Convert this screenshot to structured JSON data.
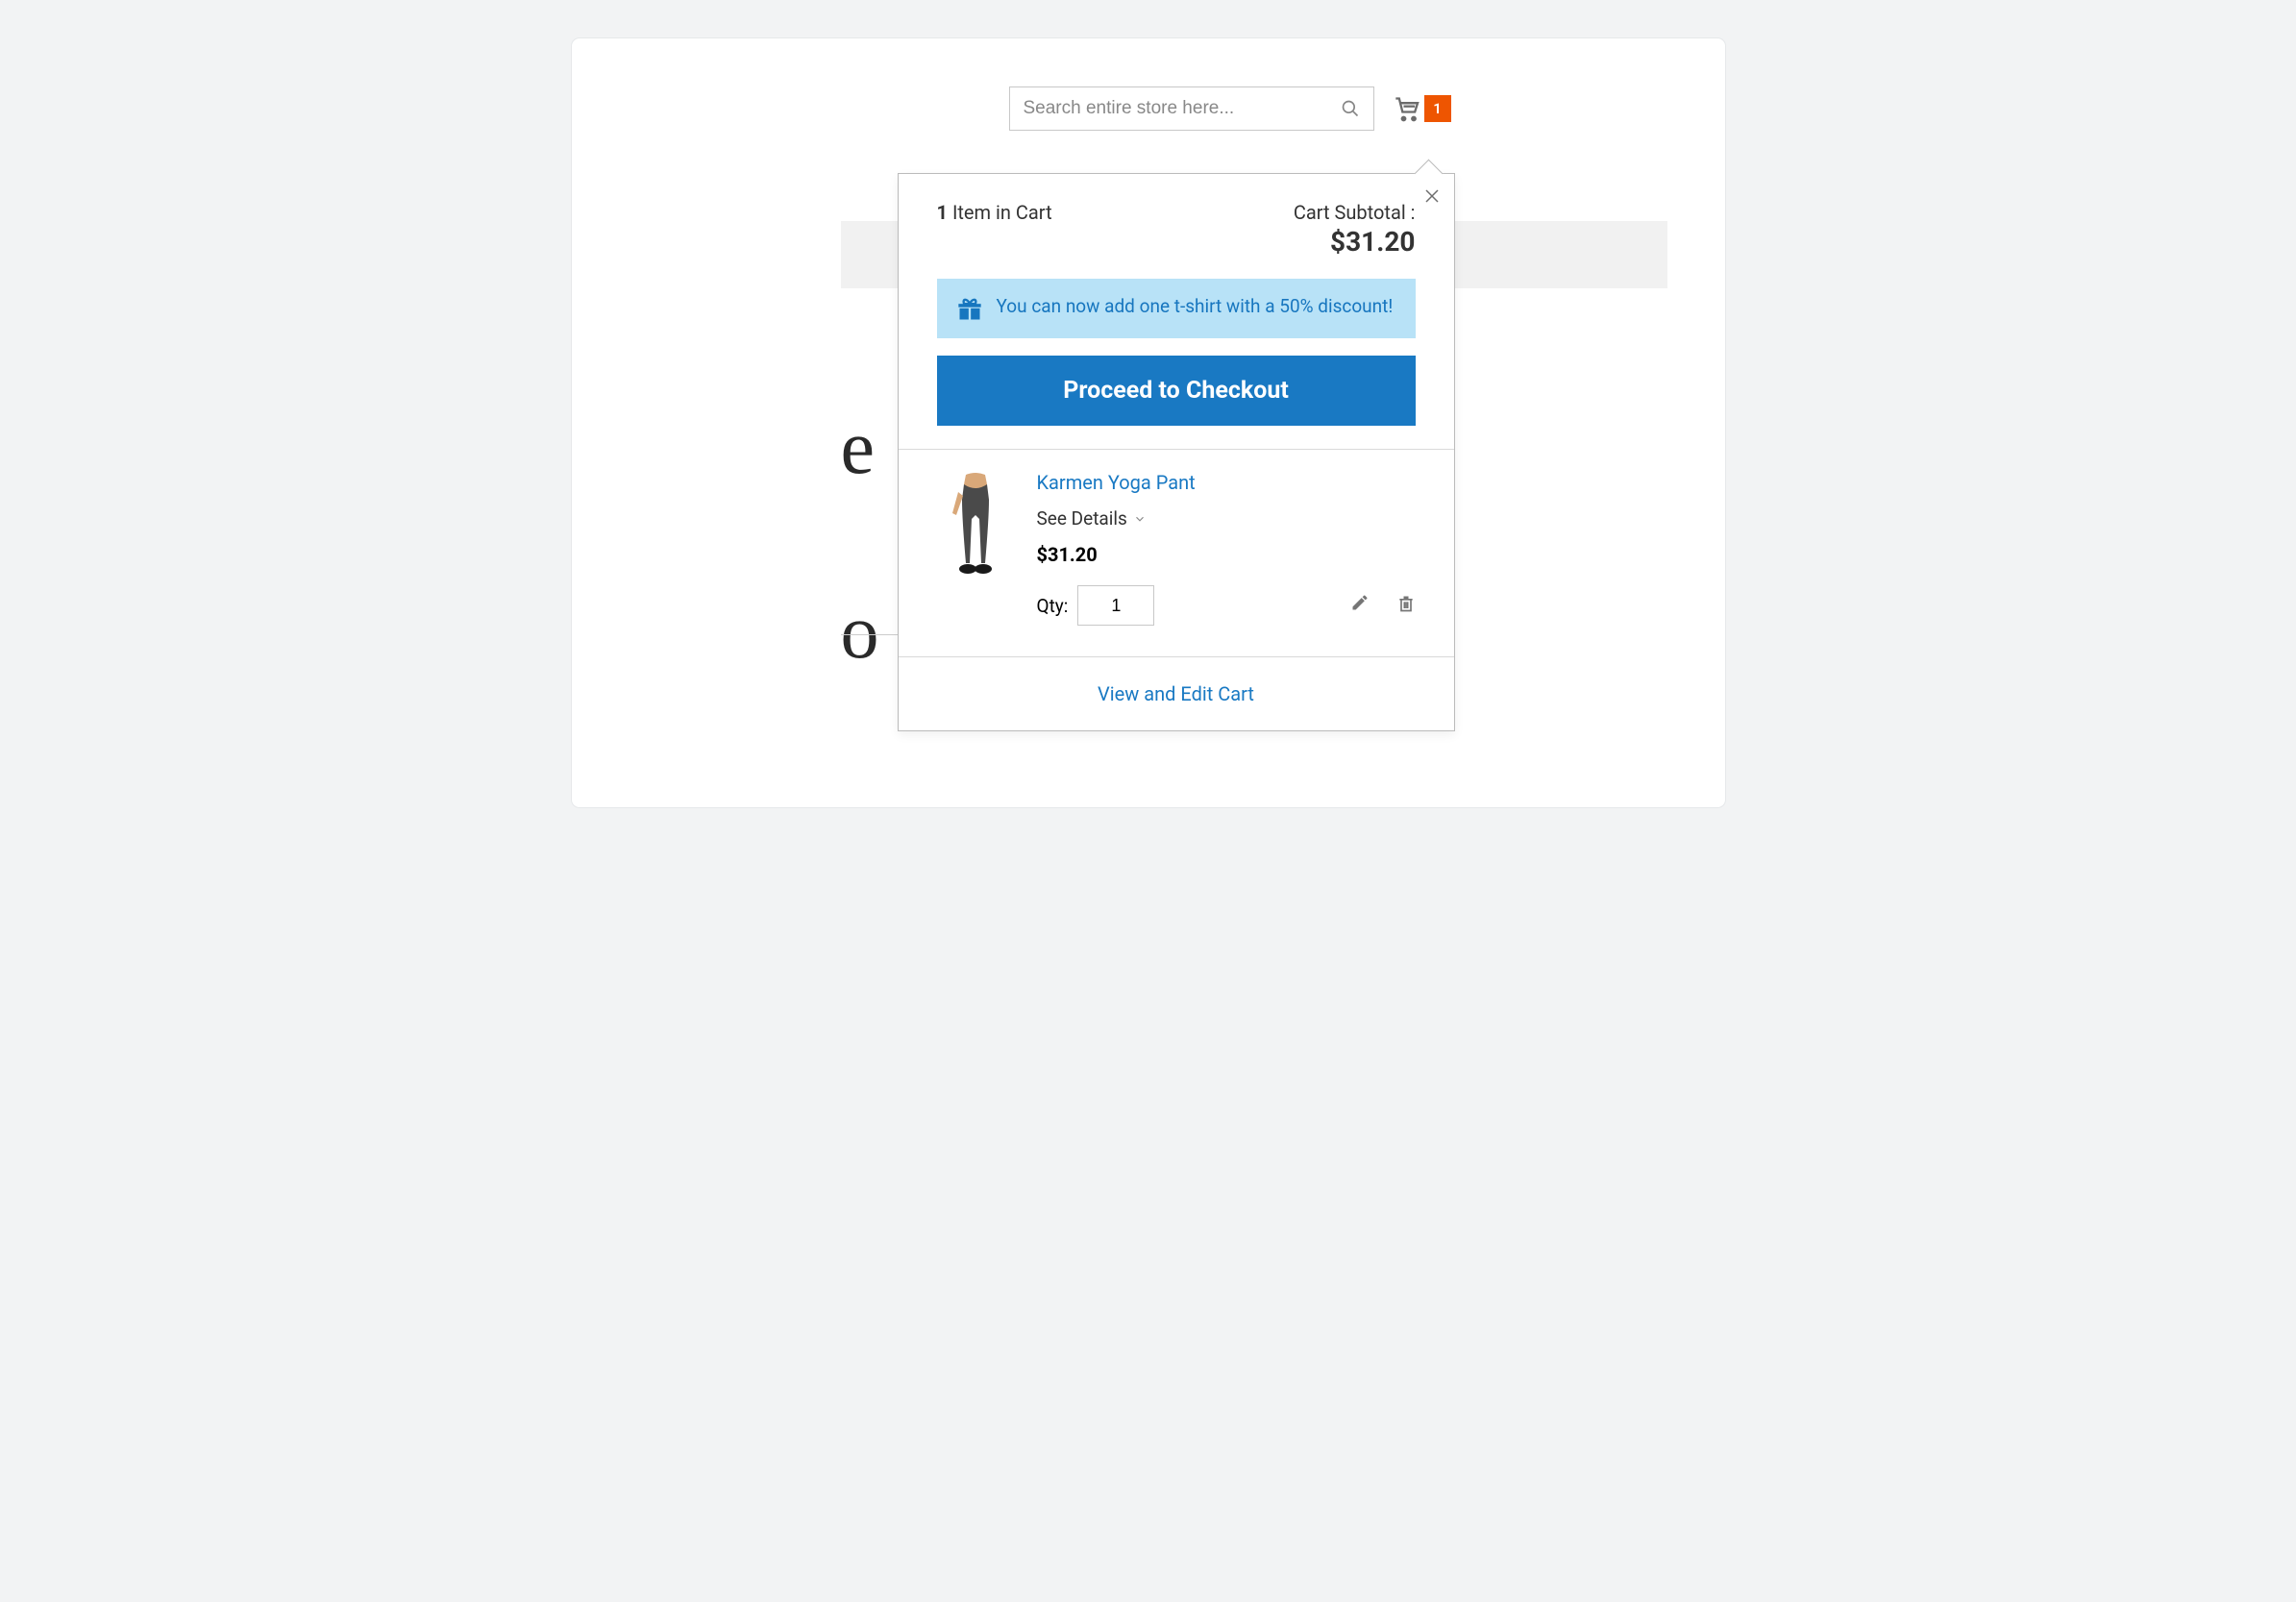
{
  "search": {
    "placeholder": "Search entire store here..."
  },
  "cart_badge_count": "1",
  "minicart": {
    "item_count": "1",
    "item_count_label": " Item in Cart",
    "subtotal_label": "Cart Subtotal :",
    "subtotal_value": "$31.20",
    "promo_message": "You can now add one t-shirt with a 50% discount!",
    "checkout_button": "Proceed to Checkout",
    "view_edit_label": "View and Edit Cart",
    "items": [
      {
        "name": "Karmen Yoga Pant",
        "see_details": "See Details",
        "price": "$31.20",
        "qty_label": "Qty:",
        "qty_value": "1"
      }
    ]
  }
}
